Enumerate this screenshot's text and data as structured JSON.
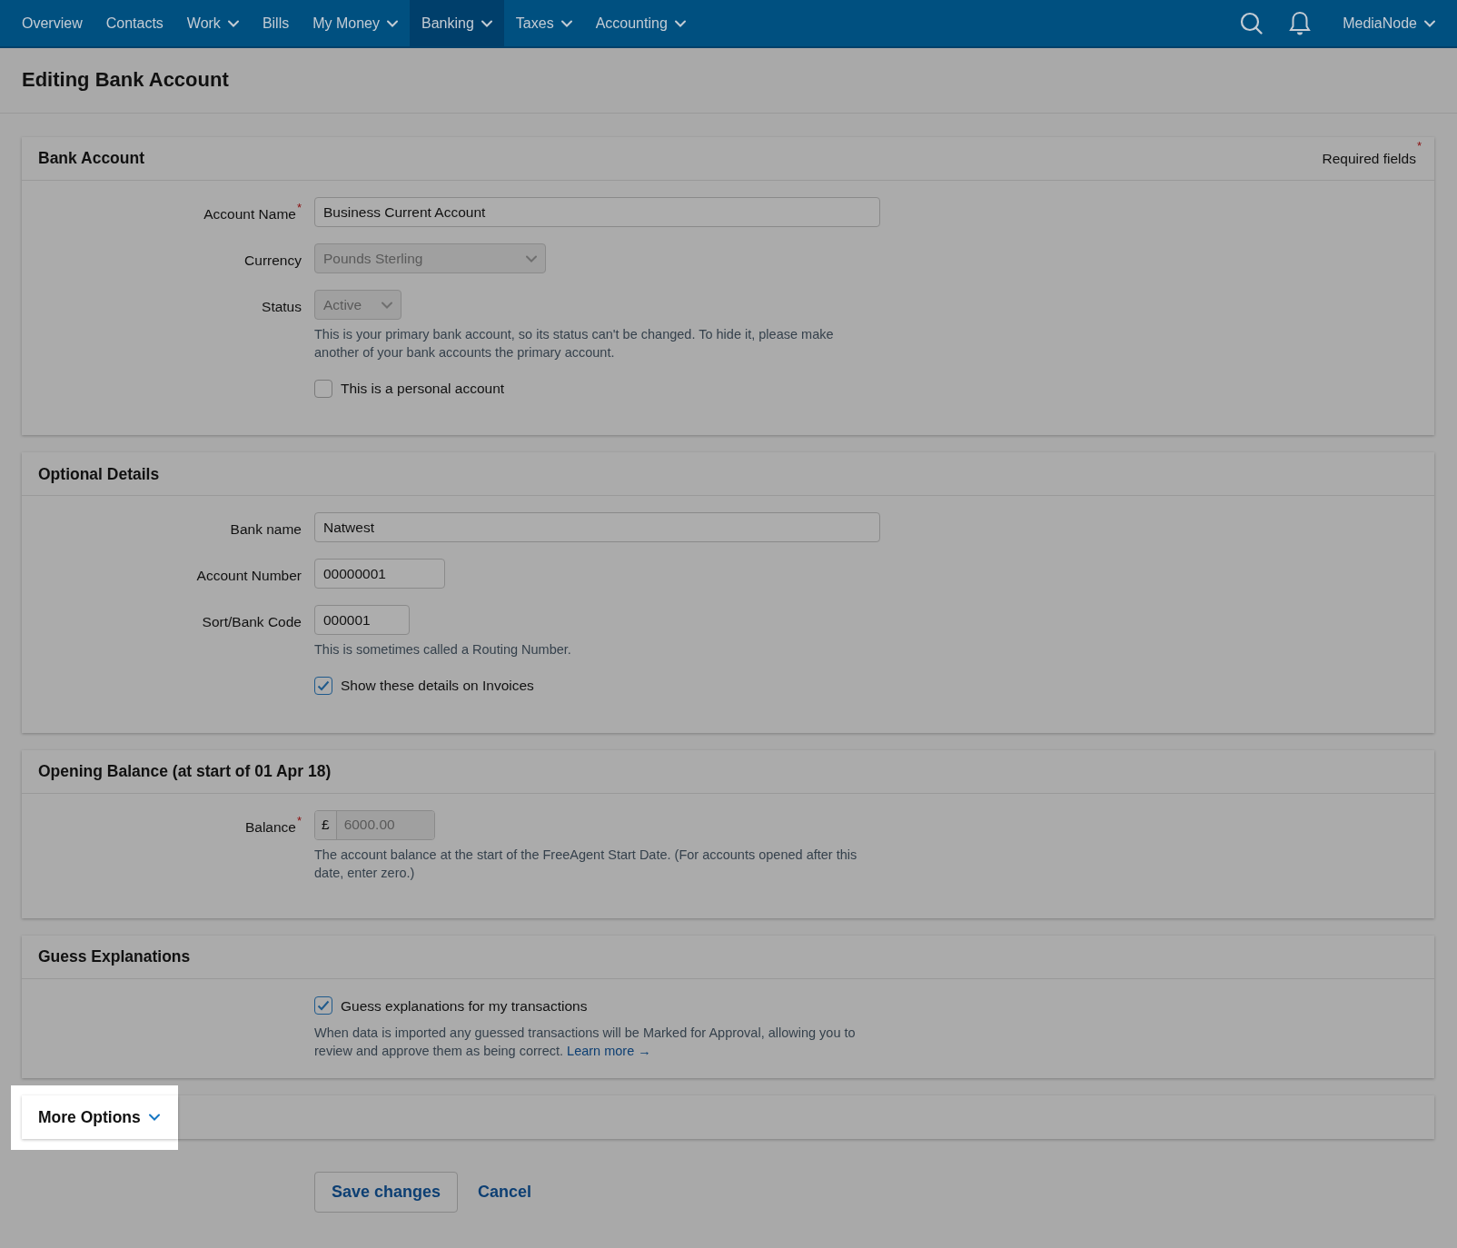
{
  "nav": {
    "items": [
      {
        "label": "Overview",
        "dropdown": false,
        "selected": false
      },
      {
        "label": "Contacts",
        "dropdown": false,
        "selected": false
      },
      {
        "label": "Work",
        "dropdown": true,
        "selected": false
      },
      {
        "label": "Bills",
        "dropdown": false,
        "selected": false
      },
      {
        "label": "My Money",
        "dropdown": true,
        "selected": false
      },
      {
        "label": "Banking",
        "dropdown": true,
        "selected": true
      },
      {
        "label": "Taxes",
        "dropdown": true,
        "selected": false
      },
      {
        "label": "Accounting",
        "dropdown": true,
        "selected": false
      }
    ],
    "user": "MediaNode"
  },
  "page_title": "Editing Bank Account",
  "sections": [
    {
      "title": "Bank Account",
      "required_note": "Required fields",
      "required_mark": "*",
      "fields": [
        {
          "kind": "text",
          "label": "Account Name",
          "required_mark": "*",
          "value": "Business Current Account"
        },
        {
          "kind": "select",
          "label": "Currency",
          "value": "Pounds Sterling",
          "disabled": true
        },
        {
          "kind": "select",
          "label": "Status",
          "value": "Active",
          "disabled": true,
          "help": "This is your primary bank account, so its status can't be changed. To hide it, please make another of your bank accounts the primary account."
        },
        {
          "kind": "checkbox",
          "label": "This is a personal account",
          "checked": false
        }
      ]
    },
    {
      "title": "Optional Details",
      "fields": [
        {
          "kind": "text",
          "label": "Bank name",
          "value": "Natwest"
        },
        {
          "kind": "text",
          "label": "Account Number",
          "value": "00000001"
        },
        {
          "kind": "text",
          "label": "Sort/Bank Code",
          "value": "000001",
          "help": "This is sometimes called a Routing Number."
        },
        {
          "kind": "checkbox",
          "label": "Show these details on Invoices",
          "checked": true
        }
      ]
    },
    {
      "title": "Opening Balance (at start of 01 Apr 18)",
      "fields": [
        {
          "kind": "money",
          "label": "Balance",
          "required_mark": "*",
          "prefix": "£",
          "value": "6000.00",
          "disabled": true,
          "help": "The account balance at the start of the FreeAgent Start Date. (For accounts opened after this date, enter zero.)"
        }
      ]
    },
    {
      "title": "Guess Explanations",
      "fields": [
        {
          "kind": "checkbox",
          "label": "Guess explanations for my transactions",
          "checked": true,
          "help": "When data is imported any guessed transactions will be Marked for Approval, allowing you to review and approve them as being correct.",
          "link": "Learn more →"
        }
      ]
    }
  ],
  "more_options": {
    "label": "More Options",
    "highlighted": true,
    "expanded": false
  },
  "actions": {
    "save": "Save changes",
    "cancel": "Cancel"
  }
}
